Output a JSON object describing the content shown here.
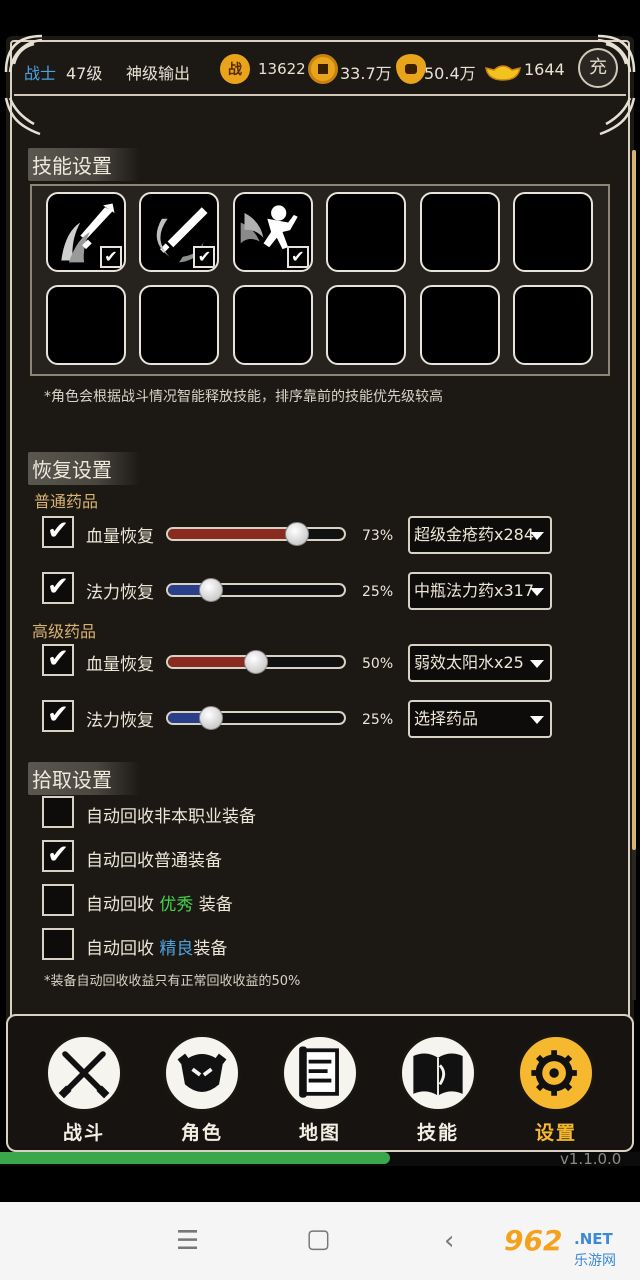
{
  "header": {
    "class_name": "战士",
    "level": "47级",
    "title": "神级输出",
    "power_value": "13622",
    "coin_value": "33.7万",
    "bag_value": "50.4万",
    "ingot_value": "1644",
    "recharge_label": "充",
    "power_icon_label": "战"
  },
  "skills": {
    "title": "技能设置",
    "note": "*角色会根据战斗情况智能释放技能，排序靠前的技能优先级较高",
    "slots": [
      {
        "filled": true,
        "icon": "sword-slash-icon",
        "checked": true
      },
      {
        "filled": true,
        "icon": "sword-spin-icon",
        "checked": true
      },
      {
        "filled": true,
        "icon": "warrior-charge-icon",
        "checked": true
      },
      {
        "filled": false
      },
      {
        "filled": false
      },
      {
        "filled": false
      },
      {
        "filled": false
      },
      {
        "filled": false
      },
      {
        "filled": false
      },
      {
        "filled": false
      },
      {
        "filled": false
      },
      {
        "filled": false
      }
    ],
    "check_mark": "✔"
  },
  "recovery": {
    "title": "恢复设置",
    "normal_title": "普通药品",
    "advanced_title": "高级药品",
    "rows": [
      {
        "label": "血量恢复",
        "percent_text": "73%",
        "value": 0.73,
        "color": "#8a2a20",
        "item": "超级金疮药x284",
        "checked": true
      },
      {
        "label": "法力恢复",
        "percent_text": "25%",
        "value": 0.25,
        "color": "#2a3f8a",
        "item": "中瓶法力药x317",
        "checked": true
      },
      {
        "label": "血量恢复",
        "percent_text": "50%",
        "value": 0.5,
        "color": "#8a2a20",
        "item": "弱效太阳水x25",
        "checked": true
      },
      {
        "label": "法力恢复",
        "percent_text": "25%",
        "value": 0.25,
        "color": "#2a3f8a",
        "item": "选择药品",
        "checked": true
      }
    ]
  },
  "pickup": {
    "title": "拾取设置",
    "rows": [
      {
        "prefix": "自动回收非本职业装备",
        "highlight": "",
        "suffix": "",
        "checked": false
      },
      {
        "prefix": "自动回收普通装备",
        "highlight": "",
        "suffix": "",
        "checked": true
      },
      {
        "prefix": "自动回收 ",
        "highlight": "优秀",
        "suffix": " 装备",
        "checked": false,
        "hl_class": "hl-green"
      },
      {
        "prefix": "自动回收 ",
        "highlight": "精良",
        "suffix": "装备",
        "checked": false,
        "hl_class": "hl-blue"
      }
    ],
    "note": "*装备自动回收收益只有正常回收收益的50%"
  },
  "nav": {
    "items": [
      {
        "label": "战斗",
        "icon": "crossed-swords-icon",
        "active": false
      },
      {
        "label": "角色",
        "icon": "helmet-icon",
        "active": false
      },
      {
        "label": "地图",
        "icon": "scroll-map-icon",
        "active": false
      },
      {
        "label": "技能",
        "icon": "spellbook-icon",
        "active": false
      },
      {
        "label": "设置",
        "icon": "gears-icon",
        "active": true
      }
    ]
  },
  "experience": 0.61,
  "version": "v1.1.0.0",
  "watermark": {
    "number": "962",
    "net": ".NET",
    "cn": "乐游网"
  },
  "colors": {
    "accent": "#f5b82e",
    "health": "#8a2a20",
    "mana": "#2a3f8a",
    "class_blue": "#4aa3e0",
    "good_green": "#44d64a"
  }
}
